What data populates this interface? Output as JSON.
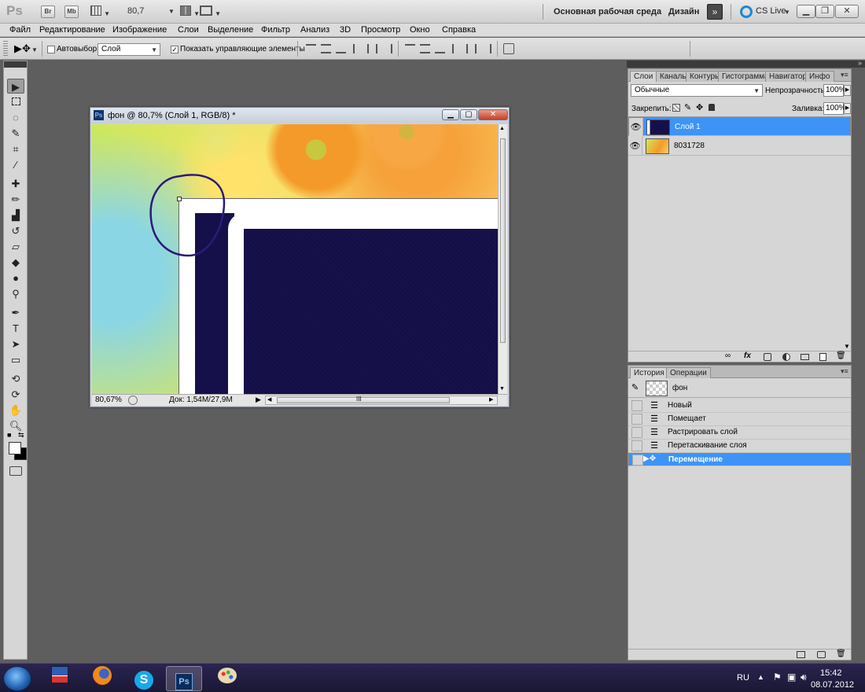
{
  "appbar": {
    "logo": "Ps",
    "bridge": "Br",
    "minibridge": "Mb",
    "zoom": "80,7",
    "workspace": "Основная рабочая среда",
    "design": "Дизайн",
    "more": "»",
    "cslive": "CS Live"
  },
  "menu": [
    "Файл",
    "Редактирование",
    "Изображение",
    "Слои",
    "Выделение",
    "Фильтр",
    "Анализ",
    "3D",
    "Просмотр",
    "Окно",
    "Справка"
  ],
  "options": {
    "autoselect_label": "Автовыбор:",
    "autoselect_value": "Слой",
    "show_controls_label": "Показать управляющие элементы"
  },
  "document": {
    "title": "фон @ 80,7% (Слой 1, RGB/8) *",
    "zoom": "80,67%",
    "doc_size": "Док: 1,54M/27,9M",
    "scroll_marker": "III"
  },
  "layers_panel": {
    "tabs": [
      "Слои",
      "Каналы",
      "Контуры",
      "Гистограмма",
      "Навигатор",
      "Инфо"
    ],
    "blend_mode": "Обычные",
    "opacity_label": "Непрозрачность:",
    "opacity_value": "100%",
    "lock_label": "Закрепить:",
    "fill_label": "Заливка:",
    "fill_value": "100%",
    "layers": [
      {
        "name": "Слой 1",
        "selected": true
      },
      {
        "name": "8031728",
        "selected": false
      }
    ]
  },
  "history_panel": {
    "tabs": [
      "История",
      "Операции"
    ],
    "snapshot": "фон",
    "items": [
      {
        "label": "Новый",
        "selected": false
      },
      {
        "label": "Помещает",
        "selected": false
      },
      {
        "label": "Растрировать слой",
        "selected": false
      },
      {
        "label": "Перетаскивание слоя",
        "selected": false
      },
      {
        "label": "Перемещение",
        "selected": true
      }
    ]
  },
  "taskbar": {
    "lang": "RU",
    "time": "15:42",
    "date": "08.07.2012"
  },
  "colors": {
    "selection": "#3d94f6",
    "dark_navy": "#15104a",
    "panel_bg": "#d6d6d6"
  }
}
